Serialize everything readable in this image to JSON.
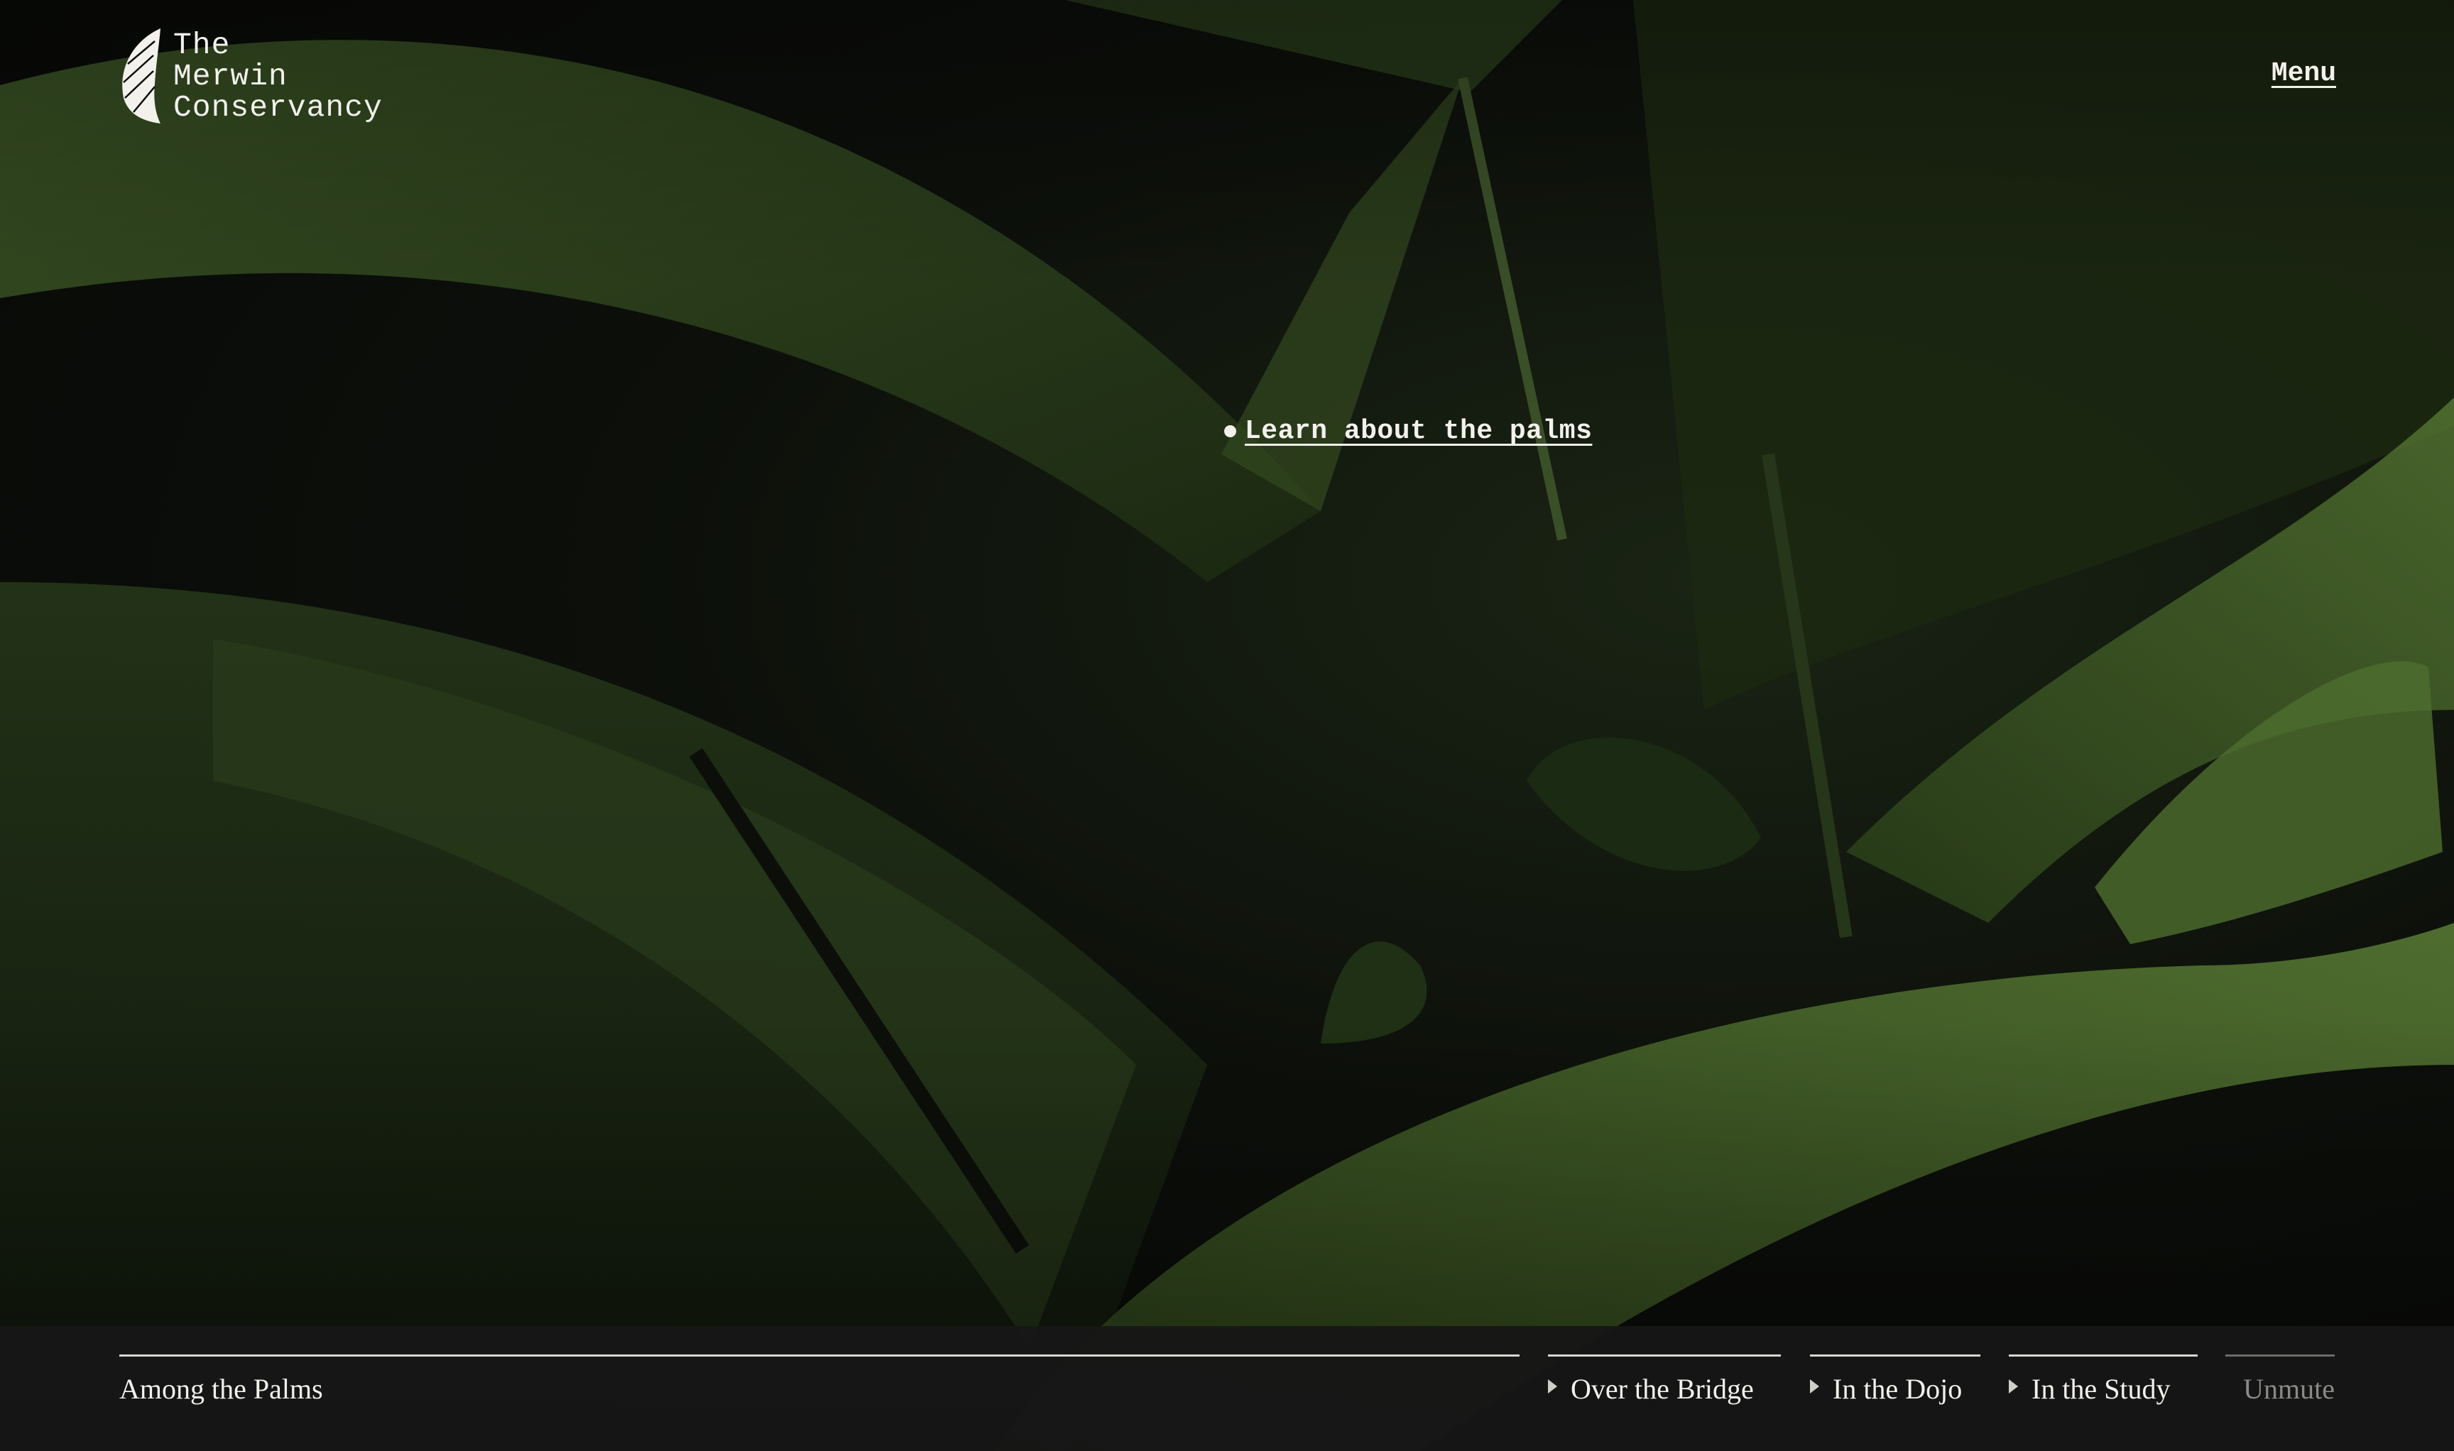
{
  "brand": {
    "name_lines": "The\nMerwin\nConservancy",
    "logo_icon": "palm-frond-icon",
    "text_color": "#f2f1ec"
  },
  "header": {
    "menu_label": "Menu"
  },
  "hotspot": {
    "label": "Learn about the palms",
    "icon": "dot-icon"
  },
  "bottom_bar": {
    "current_scene": "Among the Palms",
    "scenes": [
      {
        "label": "Over the Bridge",
        "icon": "play-triangle-icon"
      },
      {
        "label": "In the Dojo",
        "icon": "play-triangle-icon"
      },
      {
        "label": "In the Study",
        "icon": "play-triangle-icon"
      }
    ],
    "unmute_label": "Unmute",
    "background": "#161616"
  },
  "colors": {
    "foliage": "#4a6b2a",
    "background": "#0b0b0a"
  }
}
